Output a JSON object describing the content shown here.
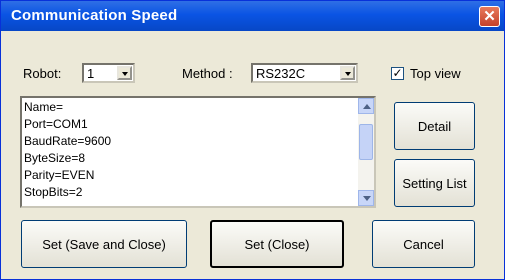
{
  "window": {
    "title": "Communication Speed",
    "close_label": "✕"
  },
  "robot": {
    "label": "Robot:",
    "value": "1"
  },
  "method": {
    "label": "Method :",
    "value": "RS232C"
  },
  "top_view": {
    "label": "Top view",
    "checked": true,
    "check_glyph": "✓"
  },
  "settings_list": [
    "Name=",
    "Port=COM1",
    "BaudRate=9600",
    "ByteSize=8",
    "Parity=EVEN",
    "StopBits=2"
  ],
  "buttons": {
    "detail": "Detail",
    "setting_list": "Setting List",
    "set_save_close": "Set (Save and Close)",
    "set_close": "Set (Close)",
    "cancel": "Cancel"
  }
}
